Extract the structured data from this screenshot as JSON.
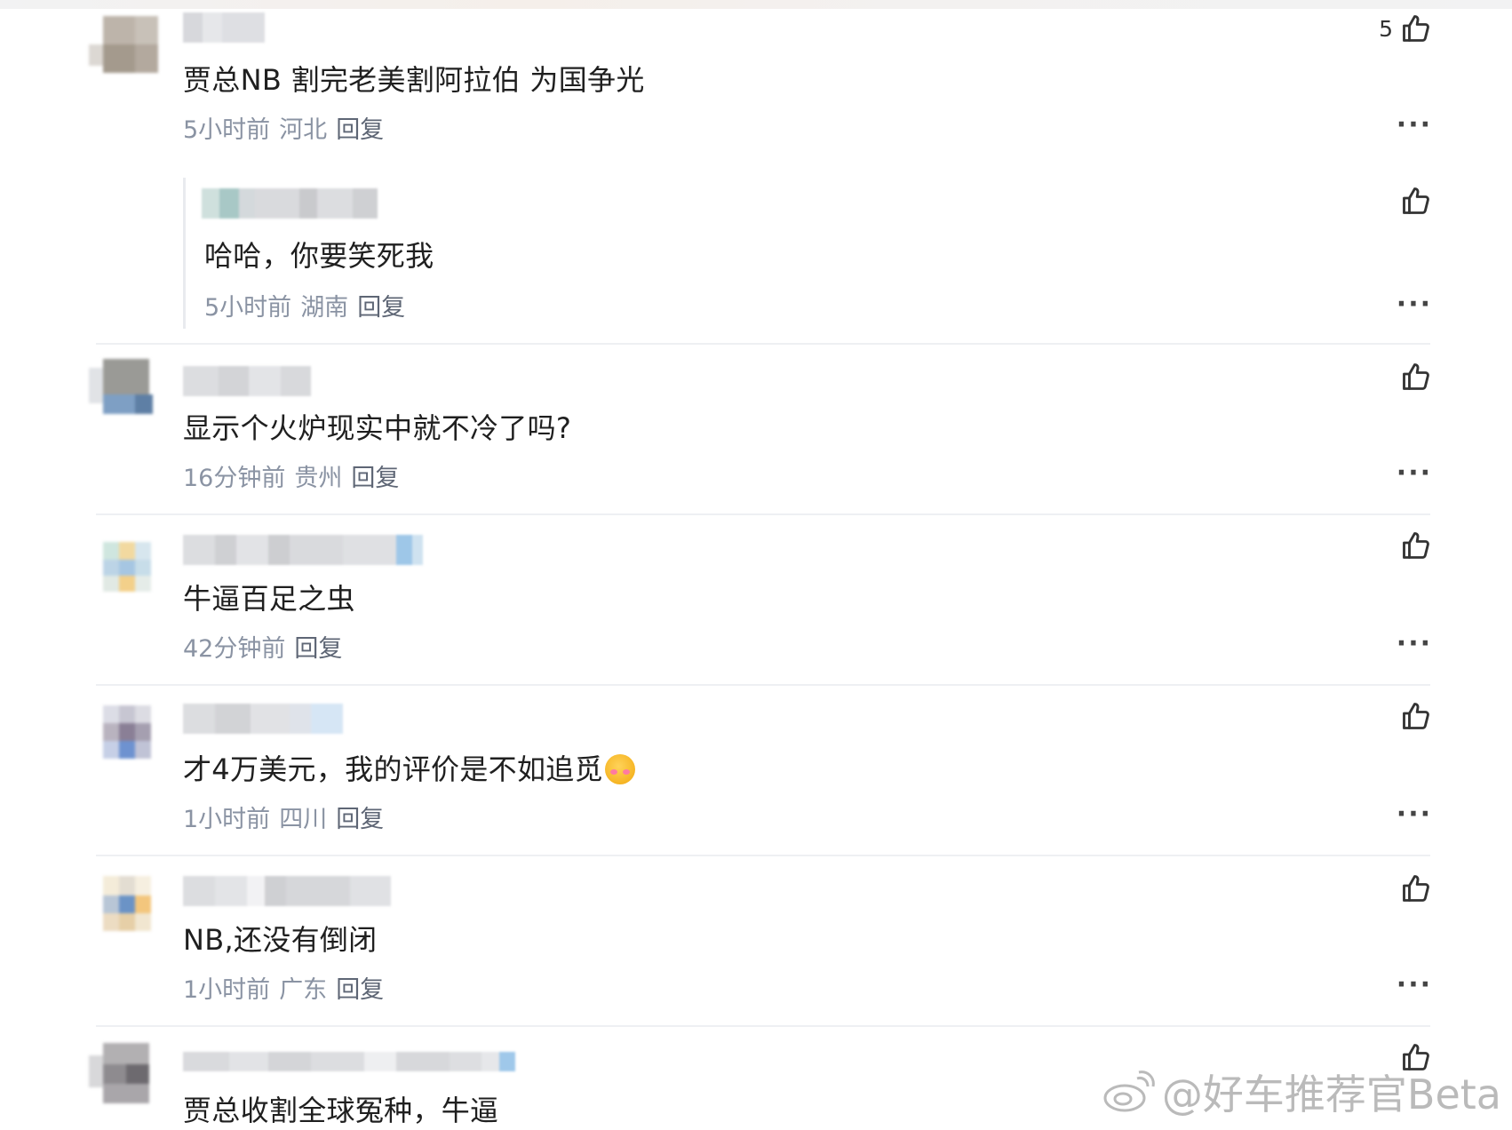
{
  "comments": [
    {
      "text": "贾总NB 割完老美割阿拉伯 为国争光",
      "time": "5小时前",
      "location": "河北",
      "reply_label": "回复",
      "likes": "5",
      "replies": [
        {
          "text": "哈哈，你要笑死我",
          "time": "5小时前",
          "location": "湖南",
          "reply_label": "回复"
        }
      ]
    },
    {
      "text": "显示个火炉现实中就不冷了吗?",
      "time": "16分钟前",
      "location": "贵州",
      "reply_label": "回复"
    },
    {
      "text": "牛逼百足之虫",
      "time": "42分钟前",
      "location": "",
      "reply_label": "回复"
    },
    {
      "text": "才4万美元，我的评价是不如追觅",
      "emoji": "face-holding-back-tears",
      "time": "1小时前",
      "location": "四川",
      "reply_label": "回复"
    },
    {
      "text": "NB,还没有倒闭",
      "time": "1小时前",
      "location": "广东",
      "reply_label": "回复"
    },
    {
      "text": "贾总收割全球冤种，牛逼"
    }
  ],
  "more_label": "···",
  "icons": {
    "like": "thumbs-up-icon",
    "more": "more-dots-icon",
    "weibo": "weibo-logo-icon"
  },
  "watermark": "@好车推荐官Beta"
}
